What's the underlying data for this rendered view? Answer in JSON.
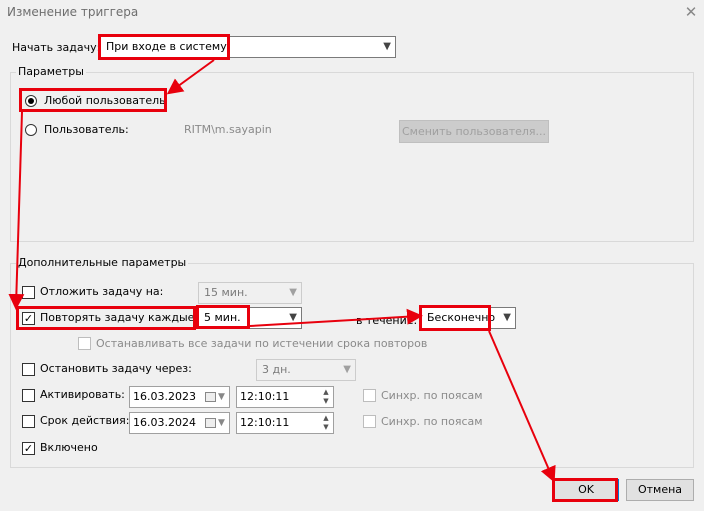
{
  "window": {
    "title": "Изменение триггера",
    "close_icon": "close-icon"
  },
  "start_task": {
    "label": "Начать задачу:",
    "value": "При входе в систему"
  },
  "params": {
    "group_label": "Параметры",
    "any_user_label": "Любой пользователь",
    "any_user_selected": true,
    "user_label": "Пользователь:",
    "user_value": "RITM\\m.sayapin",
    "change_user_button": "Сменить пользователя..."
  },
  "advanced": {
    "group_label": "Дополнительные параметры",
    "delay": {
      "label": "Отложить задачу на:",
      "checked": false,
      "value": "15 мин."
    },
    "repeat": {
      "label": "Повторять задачу каждые:",
      "checked": true,
      "value": "5 мин.",
      "duration_label": "в течение:",
      "duration_value": "Бесконечно"
    },
    "stop_all": {
      "label": "Останавливать все задачи по истечении срока повторов",
      "checked": false
    },
    "stop_after": {
      "label": "Остановить задачу через:",
      "checked": false,
      "value": "3 дн."
    },
    "activate": {
      "label": "Активировать:",
      "checked": false,
      "date": "16.03.2023",
      "time": "12:10:11",
      "sync_label": "Синхр. по поясам"
    },
    "expire": {
      "label": "Срок действия:",
      "checked": false,
      "date": "16.03.2024",
      "time": "12:10:11",
      "sync_label": "Синхр. по поясам"
    },
    "enabled": {
      "label": "Включено",
      "checked": true
    }
  },
  "buttons": {
    "ok": "OK",
    "cancel": "Отмена"
  },
  "annotation_color": "#e8000d",
  "check_mark": "✓"
}
